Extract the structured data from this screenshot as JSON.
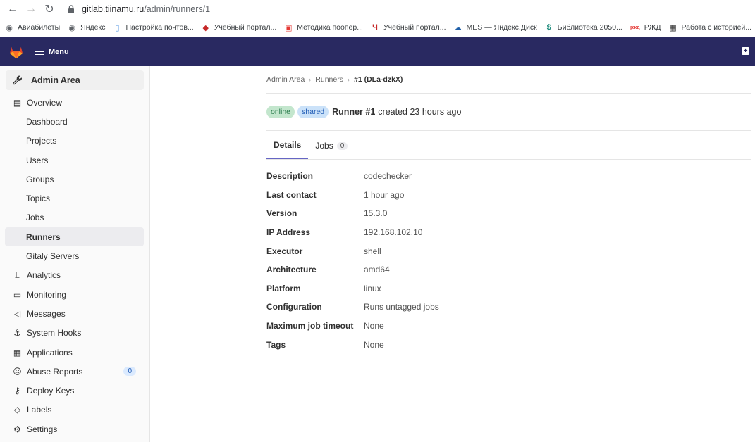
{
  "browser": {
    "url_host": "gitlab.tiinamu.ru",
    "url_path": "/admin/runners/1",
    "bookmarks": [
      {
        "label": "Авиабилеты",
        "icon": "globe-icon",
        "color": "#5f6368",
        "glyph": "◉"
      },
      {
        "label": "Яндекс",
        "icon": "globe-icon",
        "color": "#5f6368",
        "glyph": "◉"
      },
      {
        "label": "Настройка почтов...",
        "icon": "book-icon",
        "color": "#4a90e2",
        "glyph": "▯"
      },
      {
        "label": "Учебный портал...",
        "icon": "graduation-cap-icon",
        "color": "#c62828",
        "glyph": "◆"
      },
      {
        "label": "Методика поопер...",
        "icon": "pdf-icon",
        "color": "#e53935",
        "glyph": "▣"
      },
      {
        "label": "Учебный портал...",
        "icon": "portal-icon",
        "color": "#c62828",
        "glyph": "Ч"
      },
      {
        "label": "MES — Яндекс.Диск",
        "icon": "cloud-icon",
        "color": "#1e5fa8",
        "glyph": "☁"
      },
      {
        "label": "Библиотека 2050...",
        "icon": "library-icon",
        "color": "#1a8a7a",
        "glyph": "$"
      },
      {
        "label": "РЖД",
        "icon": "rzd-icon",
        "color": "#e53935",
        "glyph": "ржд"
      },
      {
        "label": "Работа с историей...",
        "icon": "bus-icon",
        "color": "#333333",
        "glyph": "▦"
      }
    ]
  },
  "topnav": {
    "menu_label": "Menu",
    "bg_color": "#292961"
  },
  "sidebar": {
    "header": "Admin Area",
    "items": [
      {
        "label": "Overview",
        "icon": "overview-icon",
        "glyph": "▤",
        "type": "section"
      },
      {
        "label": "Dashboard",
        "type": "sub"
      },
      {
        "label": "Projects",
        "type": "sub"
      },
      {
        "label": "Users",
        "type": "sub"
      },
      {
        "label": "Groups",
        "type": "sub"
      },
      {
        "label": "Topics",
        "type": "sub"
      },
      {
        "label": "Jobs",
        "type": "sub"
      },
      {
        "label": "Runners",
        "type": "sub-active"
      },
      {
        "label": "Gitaly Servers",
        "type": "sub"
      },
      {
        "label": "Analytics",
        "icon": "chart-icon",
        "glyph": "⫫",
        "type": "section"
      },
      {
        "label": "Monitoring",
        "icon": "monitor-icon",
        "glyph": "▭",
        "type": "section"
      },
      {
        "label": "Messages",
        "icon": "megaphone-icon",
        "glyph": "◁",
        "type": "section"
      },
      {
        "label": "System Hooks",
        "icon": "anchor-icon",
        "glyph": "⚓",
        "type": "section"
      },
      {
        "label": "Applications",
        "icon": "apps-icon",
        "glyph": "▦",
        "type": "section"
      },
      {
        "label": "Abuse Reports",
        "icon": "abuse-icon",
        "glyph": "☹",
        "type": "section",
        "badge": "0"
      },
      {
        "label": "Deploy Keys",
        "icon": "key-icon",
        "glyph": "⚷",
        "type": "section"
      },
      {
        "label": "Labels",
        "icon": "label-icon",
        "glyph": "◇",
        "type": "section"
      },
      {
        "label": "Settings",
        "icon": "settings-icon",
        "glyph": "⚙",
        "type": "section"
      }
    ]
  },
  "breadcrumb": {
    "items": [
      "Admin Area",
      "Runners"
    ],
    "current": "#1 (DLa-dzkX)"
  },
  "runner": {
    "status_badge": "online",
    "type_badge": "shared",
    "title": "Runner #1",
    "created": "created 23 hours ago"
  },
  "tabs": {
    "details_label": "Details",
    "jobs_label": "Jobs",
    "jobs_count": "0"
  },
  "details": [
    {
      "label": "Description",
      "value": "codechecker"
    },
    {
      "label": "Last contact",
      "value": "1 hour ago"
    },
    {
      "label": "Version",
      "value": "15.3.0"
    },
    {
      "label": "IP Address",
      "value": "192.168.102.10"
    },
    {
      "label": "Executor",
      "value": "shell"
    },
    {
      "label": "Architecture",
      "value": "amd64"
    },
    {
      "label": "Platform",
      "value": "linux"
    },
    {
      "label": "Configuration",
      "value": "Runs untagged jobs"
    },
    {
      "label": "Maximum job timeout",
      "value": "None"
    },
    {
      "label": "Tags",
      "value": "None"
    }
  ]
}
